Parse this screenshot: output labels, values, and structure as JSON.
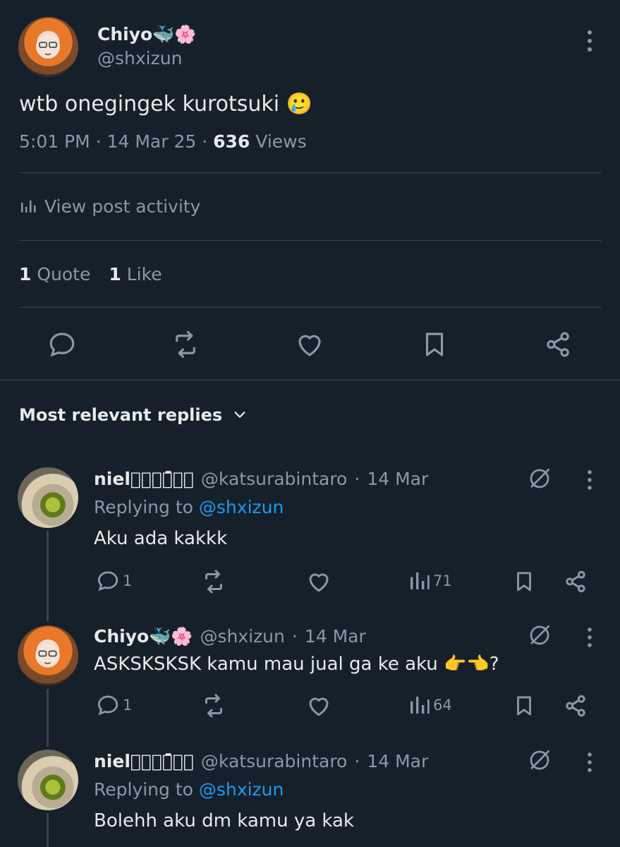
{
  "post": {
    "author_name": "Chiyo🐳🌸",
    "author_handle": "@shxizun",
    "text": "wtb onegingek kurotsuki 🥲",
    "time": "5:01 PM",
    "date": "14 Mar 25",
    "views_count": "636",
    "views_label": "Views",
    "activity_label": "View post activity",
    "quotes_count": "1",
    "quotes_label": "Quote",
    "likes_count": "1",
    "likes_label": "Like"
  },
  "replies_header": {
    "label": "Most relevant replies"
  },
  "replies": [
    {
      "name": "nielラͣͣイ͆ェͣ",
      "handle": "@katsurabintaro",
      "date": "14 Mar",
      "replying_prefix": "Replying to",
      "replying_to": "@shxizun",
      "text": "Aku ada kakkk",
      "reply_count": "1",
      "views": "71"
    },
    {
      "name": "Chiyo🐳🌸",
      "handle": "@shxizun",
      "date": "14 Mar",
      "text": "ASKSKSKSK kamu mau jual ga ke aku 👉👈?",
      "reply_count": "1",
      "views": "64"
    },
    {
      "name": "nielラͣͣイ͆ェͣ",
      "handle": "@katsurabintaro",
      "date": "14 Mar",
      "replying_prefix": "Replying to",
      "replying_to": "@shxizun",
      "text": "Bolehh aku dm kamu ya kak"
    }
  ],
  "colors": {
    "background": "#15202b",
    "text": "#e7e9ea",
    "muted": "#8b98a5",
    "accent": "#1d9bf0",
    "border": "#38444d"
  },
  "icons": [
    "more-vertical-icon",
    "analytics-icon",
    "reply-icon",
    "retweet-icon",
    "like-icon",
    "bookmark-icon",
    "share-icon",
    "chevron-down-icon",
    "grok-icon"
  ]
}
